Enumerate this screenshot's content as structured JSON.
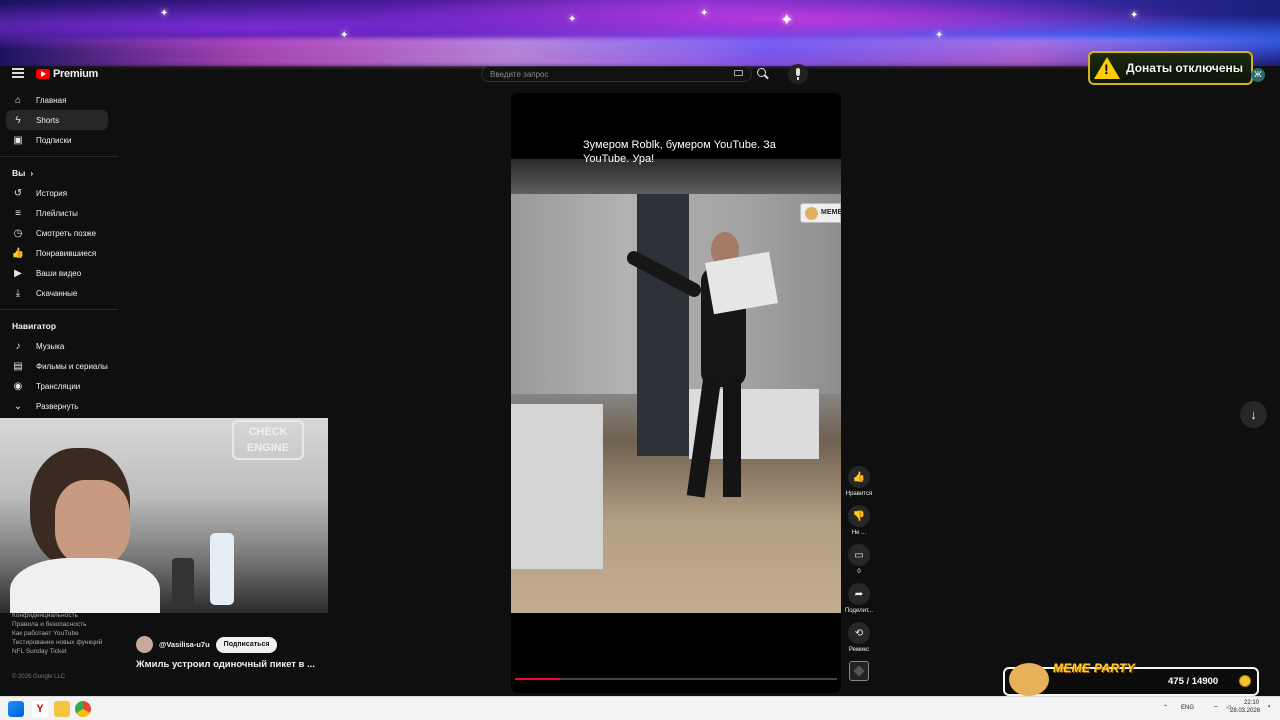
{
  "header": {
    "logo_text": "Premium",
    "search_placeholder": "Введите запрос"
  },
  "overlay": {
    "donations_label": "Донаты отключены",
    "chat_avatar": "Ж"
  },
  "sidebar": {
    "top_items": [
      {
        "label": "Главная",
        "icon": "home-icon"
      },
      {
        "label": "Shorts",
        "icon": "shorts-icon"
      },
      {
        "label": "Подписки",
        "icon": "subscriptions-icon"
      }
    ],
    "you_section": "Вы",
    "you_items": [
      {
        "label": "История",
        "icon": "history-icon"
      },
      {
        "label": "Плейлисты",
        "icon": "playlists-icon"
      },
      {
        "label": "Смотреть позже",
        "icon": "watch-later-icon"
      },
      {
        "label": "Понравившиеся",
        "icon": "liked-icon"
      },
      {
        "label": "Ваши видео",
        "icon": "your-videos-icon"
      },
      {
        "label": "Скачанные",
        "icon": "downloads-icon"
      }
    ],
    "navigator_section": "Навигатор",
    "navigator_items": [
      {
        "label": "Музыка",
        "icon": "music-icon"
      },
      {
        "label": "Фильмы и сериалы",
        "icon": "movies-icon"
      },
      {
        "label": "Трансляции",
        "icon": "live-icon"
      },
      {
        "label": "Развернуть",
        "icon": "chevron-down-icon"
      }
    ],
    "footer_links": [
      "Конфиденциальность",
      "Правила и безопасность",
      "Как работает YouTube",
      "Тестирование новых функций",
      "NFL Sunday Ticket"
    ],
    "copyright": "© 2026 Google LLC"
  },
  "webcam": {
    "sign_text": "CHECK ENGINE"
  },
  "short": {
    "caption": "Зумером Roblk, бумером YouTube. За YouTube. Ура!",
    "watermark": "MEME",
    "progress": 0.14,
    "channel": "@Vasilisa-u7u",
    "subscribe_label": "Подписаться",
    "title": "Жмиль устроил одиночный пикет в ..."
  },
  "actions": [
    {
      "label": "Нравится",
      "icon": "thumbs-up-icon"
    },
    {
      "label": "Не ...",
      "icon": "thumbs-down-icon"
    },
    {
      "label": "0",
      "icon": "comment-icon"
    },
    {
      "label": "Поделит...",
      "icon": "share-icon"
    },
    {
      "label": "Ремикс",
      "icon": "remix-icon"
    }
  ],
  "meme_party": {
    "title": "MEME PARTY",
    "count": "475 / 14900"
  },
  "taskbar": {
    "lang": "ENG",
    "time": "22:10",
    "date": "28.03.2026"
  }
}
